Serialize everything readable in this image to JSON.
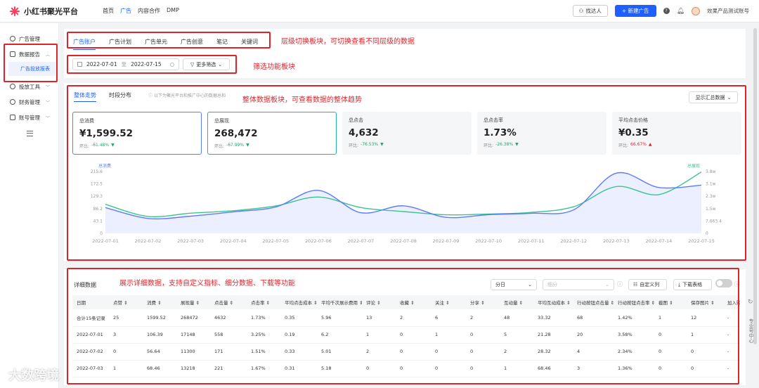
{
  "app": {
    "name": "小红书聚光平台"
  },
  "topnav": [
    "首页",
    "广告",
    "内容合作",
    "DMP"
  ],
  "topnav_active": 1,
  "topright": {
    "find_people": "找达人",
    "new_ad": "+ 新建广告",
    "account": "效果产品测试账号"
  },
  "sidebar": {
    "items": [
      {
        "label": "广告管理"
      },
      {
        "label": "数据报告"
      },
      {
        "label": "广告投放报表"
      },
      {
        "label": "投放工具"
      },
      {
        "label": "财务管理"
      },
      {
        "label": "账号管理"
      }
    ]
  },
  "level_tabs": [
    "广告账户",
    "广告计划",
    "广告单元",
    "广告创意",
    "笔记",
    "关键词"
  ],
  "level_tabs_active": 0,
  "filters": {
    "date_start": "2022-07-01",
    "date_sep": "至",
    "date_end": "2022-07-15",
    "more_filter": "更多筛选"
  },
  "overview": {
    "tabs": [
      "整体走势",
      "时段分布"
    ],
    "hint": "以下为聚光平台和推广中心的数据总和",
    "summary_select": "显示汇总数据"
  },
  "kpis": [
    {
      "label": "总消费",
      "value": "¥1,599.52",
      "change_label": "环比:",
      "change": "-61.48%",
      "dir": "down"
    },
    {
      "label": "总展现",
      "value": "268,472",
      "change_label": "环比:",
      "change": "-67.99%",
      "dir": "down"
    },
    {
      "label": "总点击",
      "value": "4,632",
      "change_label": "环比:",
      "change": "-76.53%",
      "dir": "down"
    },
    {
      "label": "总点击率",
      "value": "1.73%",
      "change_label": "环比:",
      "change": "-26.38%",
      "dir": "down"
    },
    {
      "label": "平均点击价格",
      "value": "¥0.35",
      "change_label": "环比:",
      "change": "66.67%",
      "dir": "up"
    }
  ],
  "chart_data": {
    "type": "line",
    "x": [
      "2022-07-01",
      "2022-07-02",
      "2022-07-03",
      "2022-07-04",
      "2022-07-05",
      "2022-07-06",
      "2022-07-07",
      "2022-07-08",
      "2022-07-09",
      "2022-07-10",
      "2022-07-11",
      "2022-07-12",
      "2022-07-13",
      "2022-07-14",
      "2022-07-15"
    ],
    "series": [
      {
        "name": "总消费",
        "axis": "left",
        "color": "#5b7bff",
        "values": [
          90,
          52,
          60,
          75,
          92,
          150,
          72,
          96,
          56,
          65,
          70,
          82,
          210,
          160,
          168
        ]
      },
      {
        "name": "总展现",
        "axis": "right",
        "color": "#3cc48d",
        "values": [
          18000,
          10500,
          12500,
          14000,
          17000,
          22500,
          16000,
          13500,
          11500,
          12000,
          13000,
          16500,
          29000,
          24000,
          38000
        ]
      }
    ],
    "left_ticks": [
      "0",
      "43.1",
      "86.2",
      "129.3",
      "172.5",
      "215.6"
    ],
    "right_ticks": [
      "0",
      "7,663.4",
      "1.5w",
      "2.3w",
      "3.1w",
      "3.8w"
    ],
    "ylim_left": [
      0,
      215.6
    ],
    "ylim_right": [
      0,
      38317
    ],
    "grid": false
  },
  "detail": {
    "title": "详细数据",
    "granularity": "分日",
    "breakdown_placeholder": "细分",
    "custom_columns": "自定义列",
    "download": "下载表格",
    "columns": [
      "日期",
      "点赞",
      "消费",
      "展现量",
      "点击量",
      "点击率",
      "平均点击成本",
      "平均千次展示费用",
      "评论",
      "收藏",
      "关注",
      "分享",
      "互动量",
      "平均互动成本",
      "行动按钮点击量",
      "行动按钮点击率",
      "截图",
      "保存图片",
      "加入购"
    ],
    "rows": [
      [
        "合计15条记录",
        "25",
        "1599.52",
        "268472",
        "4632",
        "1.73%",
        "0.35",
        "5.96",
        "13",
        "2",
        "6",
        "2",
        "48",
        "33.32",
        "68",
        "1.42%",
        "1",
        "12",
        "-"
      ],
      [
        "2022-07-01",
        "3",
        "106.39",
        "17148",
        "558",
        "3.25%",
        "0.19",
        "6.2",
        "1",
        "0",
        "1",
        "0",
        "5",
        "21.28",
        "20",
        "3.58%",
        "0",
        "1",
        "-"
      ],
      [
        "2022-07-02",
        "0",
        "56.64",
        "11300",
        "171",
        "1.51%",
        "0.33",
        "5.01",
        "2",
        "0",
        "0",
        "0",
        "2",
        "28.32",
        "4",
        "2.34%",
        "0",
        "0",
        "-"
      ],
      [
        "2022-07-03",
        "1",
        "68.46",
        "13218",
        "221",
        "1.67%",
        "0.31",
        "5.18",
        "0",
        "0",
        "0",
        "0",
        "1",
        "68.46",
        "3",
        "1.36%",
        "0",
        "0",
        "-"
      ]
    ]
  },
  "annotations": {
    "tabs_note": "层级切换板块，可切换查看不同层级的数据",
    "filter_note": "筛选功能板块",
    "overview_note": "整体数据板块，可查看数据的整体趋势",
    "detail_note": "展示详细数据，支持自定义指标、细分数据、下载等功能"
  },
  "rightbar": {
    "label": "专业号中心"
  },
  "watermark": "大数跨境"
}
